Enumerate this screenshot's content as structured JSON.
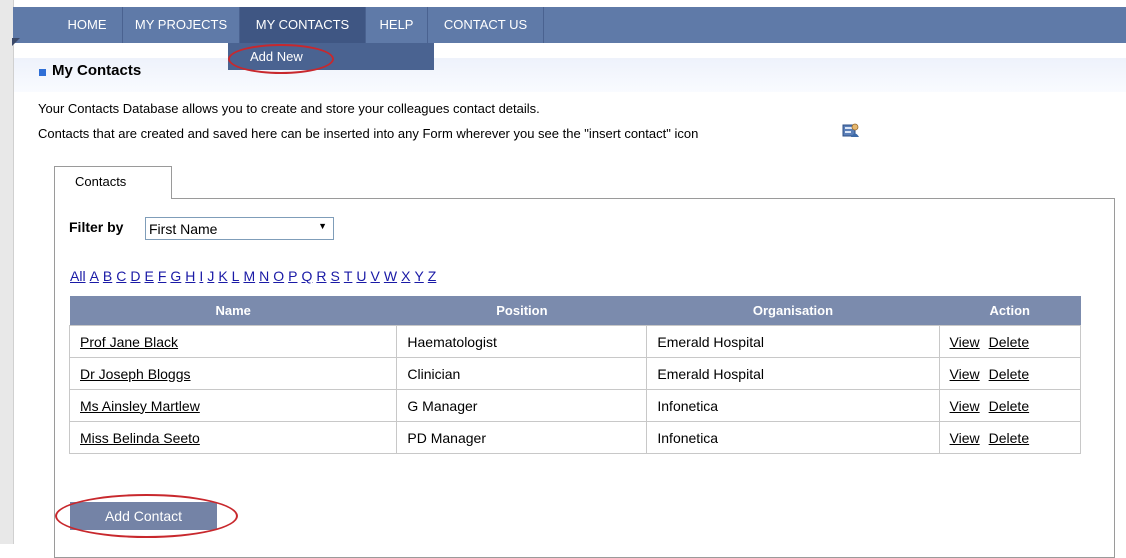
{
  "nav": {
    "items": [
      {
        "label": "HOME"
      },
      {
        "label": "MY PROJECTS"
      },
      {
        "label": "MY CONTACTS"
      },
      {
        "label": "HELP"
      },
      {
        "label": "CONTACT US"
      }
    ],
    "active": "MY CONTACTS",
    "dropdown_item": "Add New"
  },
  "page": {
    "title": "My Contacts",
    "intro_line1": "Your Contacts Database allows you to create and store your colleagues contact details.",
    "intro_line2": "Contacts that are created and saved here can be inserted into any Form wherever you see the \"insert contact\" icon"
  },
  "tab": {
    "label": "Contacts"
  },
  "filter": {
    "label": "Filter by",
    "selected": "First Name"
  },
  "alphabet": [
    "All",
    "A",
    "B",
    "C",
    "D",
    "E",
    "F",
    "G",
    "H",
    "I",
    "J",
    "K",
    "L",
    "M",
    "N",
    "O",
    "P",
    "Q",
    "R",
    "S",
    "T",
    "U",
    "V",
    "W",
    "X",
    "Y",
    "Z"
  ],
  "table": {
    "headers": [
      "Name",
      "Position",
      "Organisation",
      "Action"
    ],
    "rows": [
      {
        "name": "Prof Jane Black",
        "position": "Haematologist",
        "organisation": "Emerald Hospital"
      },
      {
        "name": "Dr Joseph Bloggs",
        "position": "Clinician",
        "organisation": "Emerald Hospital"
      },
      {
        "name": "Ms Ainsley Martlew",
        "position": "G Manager",
        "organisation": "Infonetica"
      },
      {
        "name": "Miss Belinda Seeto",
        "position": "PD Manager",
        "organisation": "Infonetica"
      }
    ],
    "action_view": "View",
    "action_delete": "Delete"
  },
  "add_button": "Add Contact",
  "colors": {
    "nav": "#5f7aa8",
    "nav_active": "#3f5683",
    "table_header": "#7b8bad",
    "highlight": "#c8282d"
  },
  "icons": {
    "insert_contact": "insert-contact-icon"
  }
}
